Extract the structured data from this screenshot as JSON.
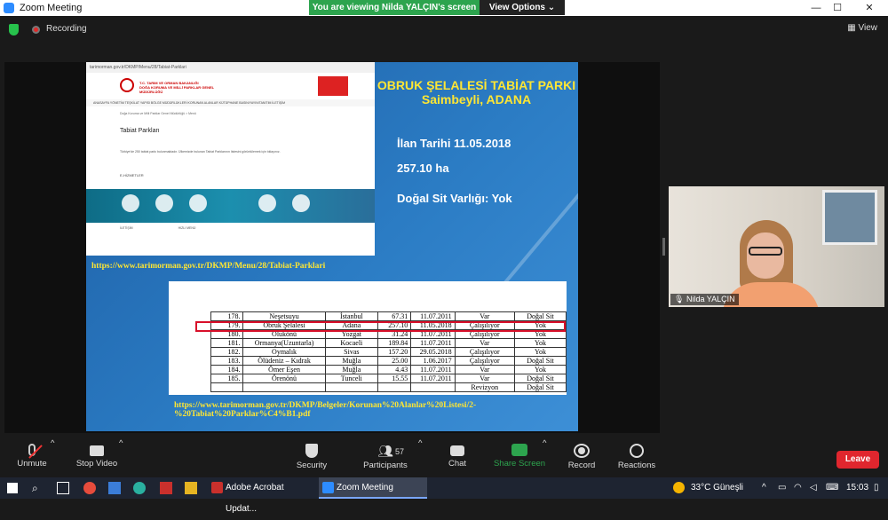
{
  "window": {
    "title": "Zoom Meeting",
    "minimize": "—",
    "maximize": "☐",
    "close": "✕"
  },
  "banner": {
    "viewing": "You are viewing Nilda YALÇIN's screen",
    "view_options": "View Options ⌄"
  },
  "meeting_bar": {
    "recording": "Recording",
    "view": "View"
  },
  "slide": {
    "title_line1": "OBRUK ŞELALESİ TABİAT PARKI",
    "title_line2": "Saimbeyli, ADANA",
    "ilan": "İlan Tarihi 11.05.2018",
    "area": "257.10 ha",
    "sit": "Doğal Sit Varlığı: Yok",
    "link1": "https://www.tarimorman.gov.tr/DKMP/Menu/28/Tabiat-Parklari",
    "link2_line1": "https://www.tarimorman.gov.tr/DKMP/Belgeler/Korunan%20Alanlar%20Listesi/2-",
    "link2_line2": "%20Tabiat%20Parklar%C4%B1.pdf",
    "web": {
      "url": "tarimorman.gov.tr/DKMP/Menu/28/Tabiat-Parklari",
      "org_line1": "T.C. TARIM VE ORMAN BAKANLIĞI",
      "org_line2": "DOĞA KORUMA VE MİLLİ PARKLAR GENEL MÜDÜRLÜĞÜ",
      "nav": "ANASAYFA   YÖNETİM   TEŞKİLAT YAPISI   BÖLGE MÜDÜRLÜKLERİ   KORUNAN ALANLAR   KÜTÜPHANE   BASIN/YAYIN/TANITIM   İLETİŞİM",
      "crumb": "Doğa Koruma ve Milli Parklar Genel Müdürlüğü > Menü",
      "heading": "Tabiat Parkları",
      "body": "Türkiye'de 250 tabiat parkı bulunmaktadır. Ülkemizde bulunan Tabiat Parklarının listesini görüntülemek için tıklayınız.",
      "services": "E-HİZMETLER",
      "footer_contact": "İLETİŞİM",
      "footer_links": "HIZLI MENÜ"
    },
    "table": {
      "rows": [
        [
          "178.",
          "Neşetsuyu",
          "İstanbul",
          "67.31",
          "11.07.2011",
          "Var",
          "Doğal Sit"
        ],
        [
          "179.",
          "Obruk Şelalesi",
          "Adana",
          "257.10",
          "11.05.2018",
          "Çalışılıyor",
          "Yok"
        ],
        [
          "180.",
          "Olukönü",
          "Yozgat",
          "31.24",
          "11.07.2011",
          "Çalışılıyor",
          "Yok"
        ],
        [
          "181.",
          "Ormanya(Uzuntarla)",
          "Kocaeli",
          "189.84",
          "11.07.2011",
          "Var",
          "Yok"
        ],
        [
          "182.",
          "Oymalık",
          "Sivas",
          "157.20",
          "29.05.2018",
          "Çalışılıyor",
          "Yok"
        ],
        [
          "183.",
          "Ölüdeniz – Kıdrak",
          "Muğla",
          "25.00",
          "1.06.2017",
          "Çalışılıyor",
          "Doğal Sit"
        ],
        [
          "184.",
          "Ömer Eşen",
          "Muğla",
          "4.43",
          "11.07.2011",
          "Var",
          "Yok"
        ],
        [
          "185.",
          "Örenönü",
          "Tunceli",
          "15.55",
          "11.07.2011",
          "Var",
          "Doğal Sit"
        ],
        [
          "",
          "",
          "",
          "",
          "",
          "Revizyon",
          "Doğal Sit"
        ]
      ]
    }
  },
  "participant": {
    "name": "Nilda YALÇIN"
  },
  "toolbar": {
    "unmute": "Unmute",
    "stop_video": "Stop Video",
    "security": "Security",
    "participants": "Participants",
    "participant_count": "57",
    "chat": "Chat",
    "share_screen": "Share Screen",
    "record": "Record",
    "reactions": "Reactions",
    "leave": "Leave",
    "caret": "^"
  },
  "taskbar": {
    "acrobat": "Adobe Acrobat Updat...",
    "zoom": "Zoom Meeting",
    "weather": "33°C  Güneşli",
    "time": "15:03",
    "tray_up": "^"
  },
  "colors": {
    "zoom_blue": "#2d8cff",
    "banner_green": "#2da44e",
    "leave_red": "#e0262e",
    "slide_yellow": "#ffe633",
    "highlight_red": "#d8102a"
  }
}
